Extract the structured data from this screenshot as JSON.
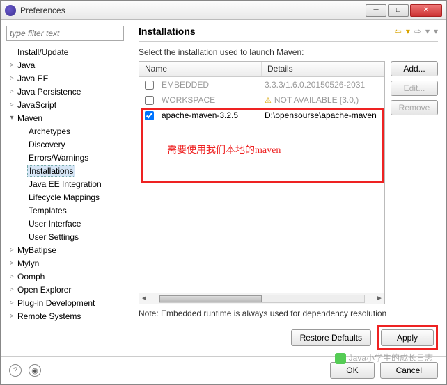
{
  "window": {
    "title": "Preferences"
  },
  "filter": {
    "placeholder": "type filter text"
  },
  "tree": {
    "items": [
      {
        "label": "Install/Update",
        "expандable": true
      },
      {
        "label": "Java",
        "expandable": true
      },
      {
        "label": "Java EE",
        "expandable": true
      },
      {
        "label": "Java Persistence",
        "expandable": true
      },
      {
        "label": "JavaScript",
        "expandable": true
      },
      {
        "label": "Maven",
        "expandable": true,
        "expanded": true,
        "children": [
          {
            "label": "Archetypes"
          },
          {
            "label": "Discovery"
          },
          {
            "label": "Errors/Warnings"
          },
          {
            "label": "Installations",
            "selected": true
          },
          {
            "label": "Java EE Integration"
          },
          {
            "label": "Lifecycle Mappings"
          },
          {
            "label": "Templates"
          },
          {
            "label": "User Interface"
          },
          {
            "label": "User Settings"
          }
        ]
      },
      {
        "label": "MyBatipse",
        "expandable": true
      },
      {
        "label": "Mylyn",
        "expandable": true
      },
      {
        "label": "Oomph",
        "expandable": true
      },
      {
        "label": "Open Explorer",
        "expandable": true
      },
      {
        "label": "Plug-in Development",
        "expandable": true
      },
      {
        "label": "Remote Systems",
        "expandable": true
      }
    ]
  },
  "page": {
    "heading": "Installations",
    "instruction": "Select the installation used to launch Maven:",
    "columns": {
      "name": "Name",
      "details": "Details"
    },
    "rows": [
      {
        "checked": false,
        "name": "EMBEDDED",
        "details": "3.3.3/1.6.0.20150526-2031",
        "disabled": true
      },
      {
        "checked": false,
        "name": "WORKSPACE",
        "details": "NOT AVAILABLE [3.0,)",
        "disabled": true,
        "warn": true
      },
      {
        "checked": true,
        "name": "apache-maven-3.2.5",
        "details": "D:\\opensourse\\apache-maven",
        "disabled": false
      }
    ],
    "annotation": "需要使用我们本地的maven",
    "buttons": {
      "add": "Add...",
      "edit": "Edit...",
      "remove": "Remove"
    },
    "note": "Note: Embedded runtime is always used for dependency resolution",
    "restore": "Restore Defaults",
    "apply": "Apply"
  },
  "footer": {
    "ok": "OK",
    "cancel": "Cancel"
  },
  "watermark": "Java小学生的成长日志"
}
